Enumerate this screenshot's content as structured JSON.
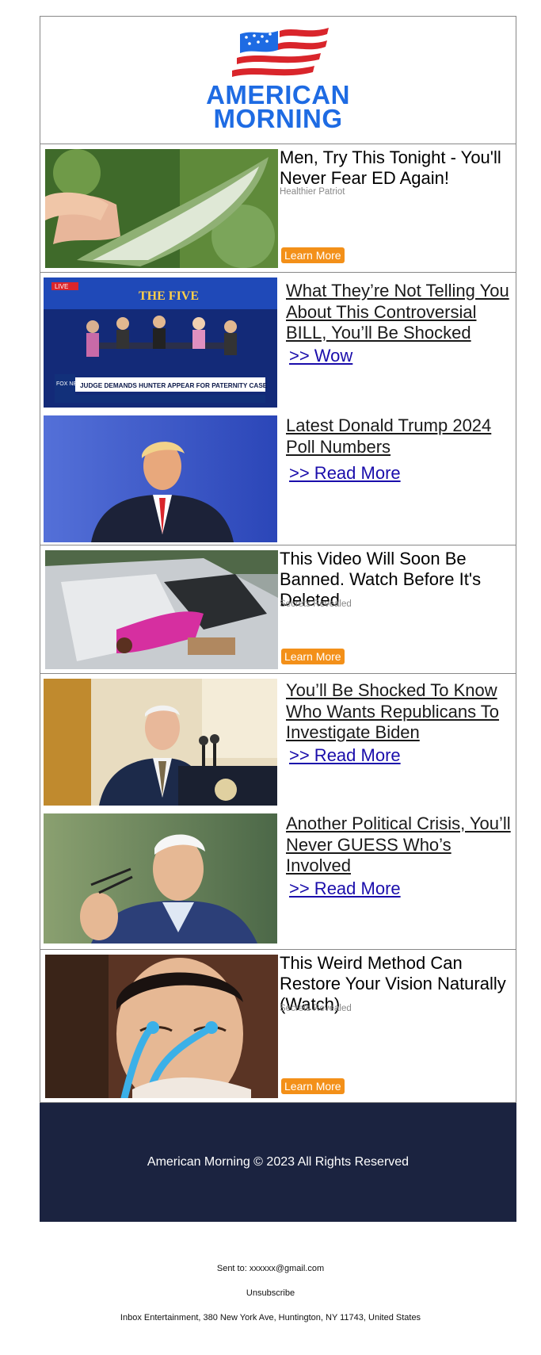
{
  "brand": {
    "name_line1": "AMERICAN",
    "name_line2": "MORNING",
    "color": "#1e6be3",
    "flag_red": "#d9252b"
  },
  "ads": [
    {
      "headline": "Men, Try This Tonight - You'll Never Fear ED Again!",
      "sponsor": "Healthier Patriot",
      "cta": "Learn More",
      "image": "aloe-vera-leaf-photo"
    },
    {
      "headline": "This Video Will Soon Be Banned. Watch Before It's Deleted",
      "sponsor": "Secrets Revealed",
      "cta": "Learn More",
      "image": "woman-crawling-from-sports-car-photo"
    },
    {
      "headline": "This Weird Method Can Restore Your Vision Naturally (Watch)",
      "sponsor": "Secrets Revealed",
      "cta": "Learn More",
      "image": "woman-with-eye-massager-photo"
    }
  ],
  "stories": [
    {
      "title": "What They’re Not Telling You About This Controversial BILL, You’ll Be Shocked",
      "link": ">> Wow",
      "image": "tv-news-panel-photo",
      "chyron": "JUDGE DEMANDS HUNTER APPEAR FOR PATERNITY CASE",
      "show": "THE FIVE",
      "network": "FOX NEWS"
    },
    {
      "title": "Latest Donald Trump 2024 Poll Numbers",
      "link": ">> Read More",
      "image": "trump-portrait-photo"
    },
    {
      "title": "You’ll Be Shocked To Know Who Wants Republicans To Investigate Biden",
      "link": ">> Read More",
      "image": "biden-at-podium-photo"
    },
    {
      "title": "Another Political Crisis, You’ll Never GUESS Who’s Involved",
      "link": ">> Read More",
      "image": "biden-with-glasses-photo"
    }
  ],
  "footer": {
    "copyright": "American Morning © 2023 All Rights Reserved",
    "sent_to": "Sent to: xxxxxx@gmail.com",
    "unsubscribe": "Unsubscribe",
    "address": "Inbox Entertainment, 380 New York Ave, Huntington, NY 11743, United States"
  },
  "colors": {
    "cta": "#f39019",
    "footer_bg": "#1b2340",
    "link": "#1a0dab",
    "sponsor": "#888888"
  }
}
